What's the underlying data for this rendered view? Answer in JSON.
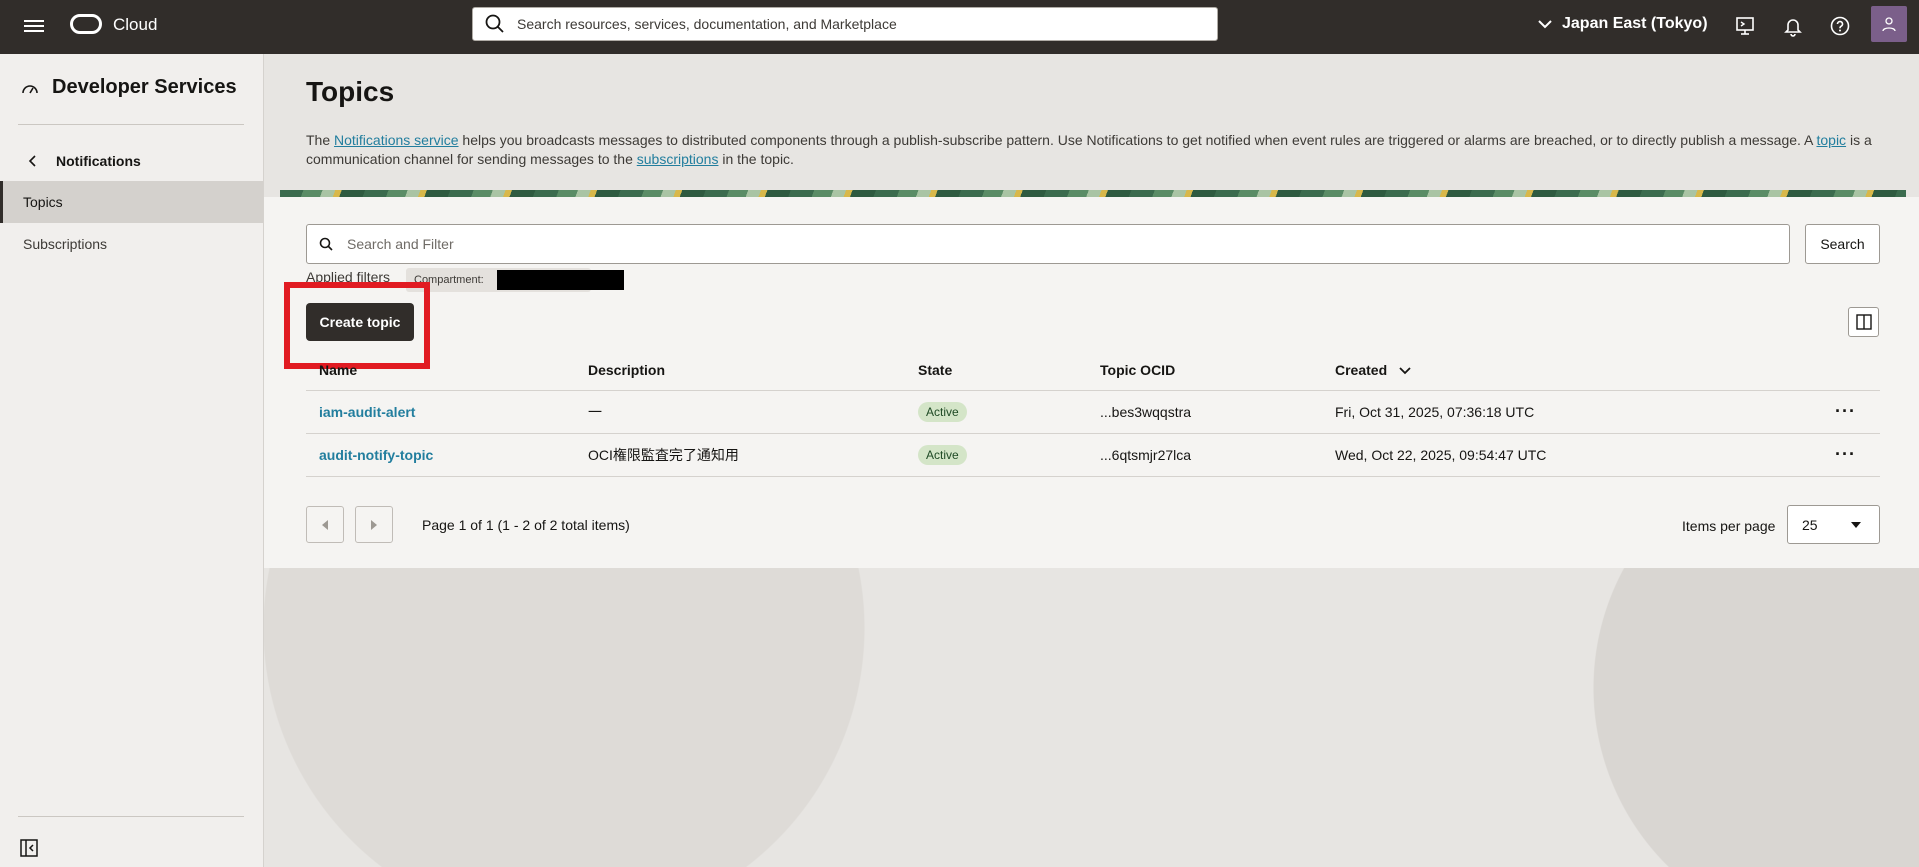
{
  "topbar": {
    "brand": "Cloud",
    "search_placeholder": "Search resources, services, documentation, and Marketplace",
    "region": "Japan East (Tokyo)"
  },
  "sidebar": {
    "title": "Developer Services",
    "back_label": "Notifications",
    "items": [
      {
        "label": "Topics",
        "active": true
      },
      {
        "label": "Subscriptions",
        "active": false
      }
    ]
  },
  "main": {
    "title": "Topics",
    "desc_1": "The ",
    "desc_link_1": "Notifications service",
    "desc_2": " helps you broadcasts messages to distributed components through a publish-subscribe pattern. Use Notifications to get notified when event rules are triggered or alarms are breached, or to directly publish a message. A ",
    "desc_link_2": "topic",
    "desc_3": " is a communication channel for sending messages to the ",
    "desc_link_3": "subscriptions",
    "desc_4": " in the topic.",
    "filter_placeholder": "Search and Filter",
    "search_button": "Search",
    "applied_filters": "Applied filters",
    "chip_label": "Compartment: ",
    "create_button": "Create topic"
  },
  "table": {
    "headers": [
      "Name",
      "Description",
      "State",
      "Topic OCID",
      "Created"
    ],
    "rows": [
      {
        "name": "iam-audit-alert",
        "description": "一",
        "state": "Active",
        "ocid": "...bes3wqqstra",
        "created": "Fri, Oct 31, 2025, 07:36:18 UTC"
      },
      {
        "name": "audit-notify-topic",
        "description": "OCI権限監査完了通知用",
        "state": "Active",
        "ocid": "...6qtsmjr27lca",
        "created": "Wed, Oct 22, 2025, 09:54:47 UTC"
      }
    ]
  },
  "pagination": {
    "text": "Page 1 of 1 (1 - 2 of 2 total items)",
    "items_per_page_label": "Items per page",
    "items_per_page_value": "25"
  }
}
